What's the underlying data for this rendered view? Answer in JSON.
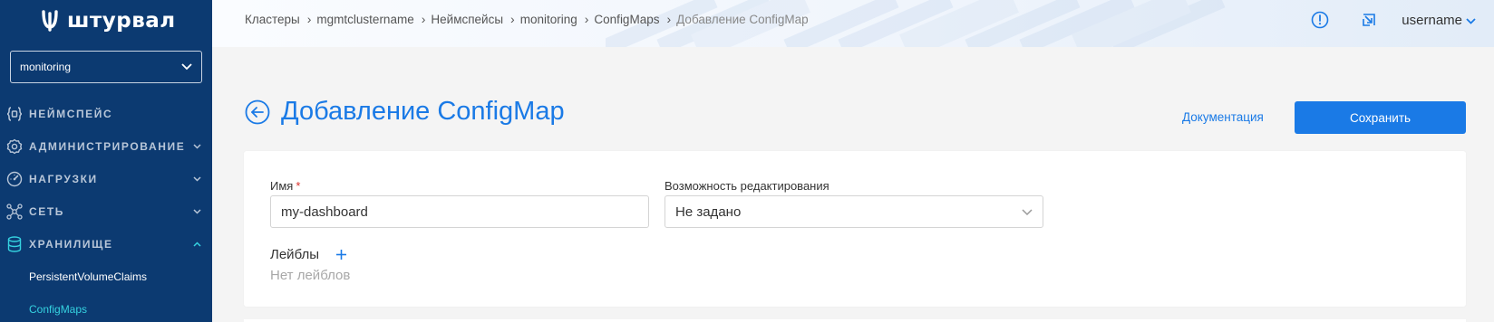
{
  "app": {
    "logo_text": "штурвал"
  },
  "sidebar": {
    "namespace_select": {
      "value": "monitoring"
    },
    "items": [
      {
        "label": "Неймспейс",
        "icon": "namespace-braces-icon",
        "has_chevron": false
      },
      {
        "label": "Администрирование",
        "icon": "gear-icon",
        "has_chevron": true
      },
      {
        "label": "Нагрузки",
        "icon": "gauge-icon",
        "has_chevron": true
      },
      {
        "label": "Сеть",
        "icon": "network-icon",
        "has_chevron": true
      },
      {
        "label": "Хранилище",
        "icon": "database-icon",
        "has_chevron": true,
        "expanded": true
      }
    ],
    "subitems": [
      {
        "label": "PersistentVolumeClaims",
        "active": false
      },
      {
        "label": "ConfigMaps",
        "active": true
      }
    ]
  },
  "topbar": {
    "breadcrumb": [
      {
        "label": "Кластеры"
      },
      {
        "label": "mgmtclustername"
      },
      {
        "label": "Неймспейсы"
      },
      {
        "label": "monitoring"
      },
      {
        "label": "ConfigMaps"
      },
      {
        "label": "Добавление ConfigMap",
        "current": true
      }
    ],
    "username": "username"
  },
  "page": {
    "title": "Добавление ConfigMap",
    "doc_link": "Документация",
    "save_label": "Сохранить"
  },
  "form": {
    "name_label": "Имя",
    "name_required_mark": "*",
    "name_value": "my-dashboard",
    "editability_label": "Возможность редактирования",
    "editability_value": "Не задано",
    "labels_label": "Лейблы",
    "labels_empty": "Нет лейблов"
  },
  "colors": {
    "sidebar_bg": "#0c3a71",
    "accent": "#1a7ae6",
    "active_nav": "#35d2e0",
    "required": "#d9302b"
  }
}
